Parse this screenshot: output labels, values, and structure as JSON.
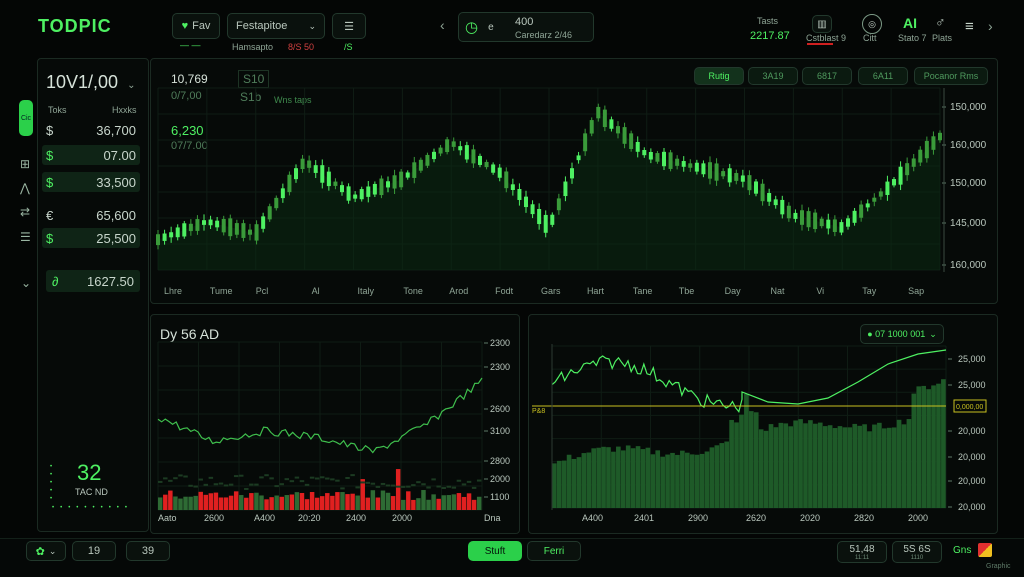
{
  "app": {
    "title": "TODPIC"
  },
  "topbar": {
    "fav_label": "Fav",
    "fav_sub": "— —",
    "dropdown_value": "Festapitoe",
    "dropdown_sub1": "Hamsapto",
    "dropdown_sub2": "8/S 50",
    "menu_sub": "/S",
    "nav_prev": "‹",
    "clock_value": "400",
    "clock_sub": "Caredarz 2/46",
    "clock_icon_sub": "e",
    "stat1_label": "Tasts",
    "stat1_value": "2217.87",
    "stat2_label": "Cstblast 9",
    "stat3_label": "Citt",
    "stat4_value": "AI",
    "stat4_label": "Stato 7",
    "stat5_label": "Plats",
    "nav_next": "›"
  },
  "sidebar": {
    "active_item": "Cic",
    "header_value": "10V1/,00",
    "col1": "Toks",
    "col2": "Hxxks",
    "rows": [
      {
        "sym": "$",
        "val": "36,700",
        "hl": false
      },
      {
        "sym": "$",
        "val": "07.00",
        "hl": true
      },
      {
        "sym": "$",
        "val": "33,500",
        "hl": true
      },
      {
        "sym": "€",
        "val": "65,600",
        "hl": false
      },
      {
        "sym": "$",
        "val": "25,500",
        "hl": true
      }
    ],
    "total_sym": "∂",
    "total_val": "1627.50",
    "counter_value": "32",
    "counter_label": "TAC ND"
  },
  "main_chart": {
    "info1": "10,769",
    "info2": "0/7,00",
    "info3": "6,230",
    "info4": "07/7.00",
    "info5": "S10",
    "info6": "S1b",
    "info_label": "Wns taps",
    "tabs": [
      "Rutig",
      "3A19",
      "6817",
      "6A11",
      "Pocanor Rms"
    ],
    "y_labels": [
      "150,000",
      "160,000",
      "150,000",
      "145,000",
      "160,000"
    ],
    "x_labels": [
      "Lhre",
      "Tume",
      "Pcl",
      "Al",
      "Italy",
      "Tone",
      "Arod",
      "Fodt",
      "Gars",
      "Hart",
      "Tane",
      "Tbe",
      "Day",
      "Nat",
      "Vi",
      "Tay",
      "Sap"
    ]
  },
  "chart_left": {
    "title": "Dy 56 AD",
    "y_labels": [
      "2300",
      "2300",
      "2600",
      "3100",
      "2800",
      "2000",
      "1100"
    ],
    "x_labels": [
      "Aato",
      "2600",
      "A400",
      "20:20",
      "2400",
      "2000",
      "Dna"
    ]
  },
  "chart_right": {
    "dropdown": "● 07 1000 001",
    "y_labels": [
      "25,000",
      "25,000",
      "20,000",
      "20,000",
      "20,000",
      "20,000"
    ],
    "x_labels": [
      "A400",
      "2401",
      "2900",
      "2620",
      "2020",
      "2820",
      "2000"
    ],
    "left_tag": "P&8",
    "right_tag": "0,000,00"
  },
  "bottom": {
    "left_val1": "19",
    "left_val2": "39",
    "btn_primary": "Stuft",
    "btn_secondary": "Ferri",
    "right_val1": "51,48",
    "right_sub1": "11:11",
    "right_val2": "5S 6S",
    "right_sub2": "1110",
    "right_label": "Gns",
    "corner": "Graphic"
  },
  "colors": {
    "accent": "#2bd04a",
    "candle_up": "#4ef062",
    "candle_down": "#3a9b3a",
    "volume_red": "#e02020",
    "bg": "#040605"
  },
  "chart_data": [
    {
      "type": "line",
      "title": "",
      "xlabel": "",
      "ylabel": "",
      "x": [
        "Lhre",
        "Tume",
        "Pcl",
        "Al",
        "Italy",
        "Tone",
        "Arod",
        "Fodt",
        "Gars",
        "Hart",
        "Tane",
        "Tbe",
        "Day",
        "Nat",
        "Vi",
        "Tay",
        "Sap"
      ],
      "series": [
        {
          "values": [
            145500,
            147000,
            146000,
            152000,
            149000,
            150500,
            153500,
            151000,
            146500,
            156000,
            152500,
            151500,
            150500,
            147500,
            146500,
            150000,
            154000
          ]
        }
      ],
      "y_tick_labels": [
        "150,000",
        "160,000",
        "150,000",
        "145,000",
        "160,000"
      ]
    },
    {
      "type": "line",
      "title": "Dy 56 AD",
      "x": [
        "Aato",
        "2600",
        "A400",
        "20:20",
        "2400",
        "2000",
        "Dna"
      ],
      "series": [
        {
          "values": [
            2400,
            2050,
            2200,
            2100,
            1900,
            2300,
            2900
          ]
        }
      ],
      "volume": [
        1150,
        1170,
        1200,
        1180,
        1220,
        1210,
        1260
      ]
    },
    {
      "type": "area",
      "x": [
        "A400",
        "2401",
        "2900",
        "2620",
        "2020",
        "2820",
        "2000"
      ],
      "series": [
        {
          "values": [
            21500,
            24500,
            23000,
            22000,
            22500,
            24000,
            25000
          ]
        }
      ]
    }
  ]
}
